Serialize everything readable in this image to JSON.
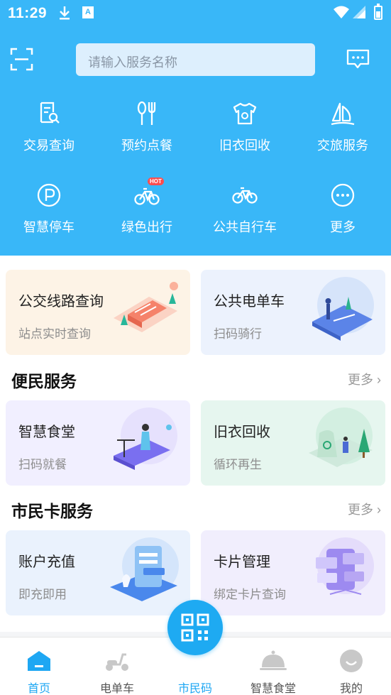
{
  "status_bar": {
    "time": "11:29",
    "notification_badge": "A"
  },
  "search": {
    "placeholder": "请输入服务名称"
  },
  "grid": [
    {
      "label": "交易查询",
      "icon": "receipt-search-icon"
    },
    {
      "label": "预约点餐",
      "icon": "fork-spoon-icon"
    },
    {
      "label": "旧衣回收",
      "icon": "shirt-recycle-icon"
    },
    {
      "label": "交旅服务",
      "icon": "sailboat-icon"
    },
    {
      "label": "智慧停车",
      "icon": "parking-icon"
    },
    {
      "label": "绿色出行",
      "icon": "bicycle-icon",
      "badge": "HOT"
    },
    {
      "label": "公共自行车",
      "icon": "bicycle-icon"
    },
    {
      "label": "更多",
      "icon": "more-dots-icon"
    }
  ],
  "travel_cards": [
    {
      "title": "公交线路查询",
      "subtitle": "站点实时查询"
    },
    {
      "title": "公共电单车",
      "subtitle": "扫码骑行"
    }
  ],
  "convenience": {
    "title": "便民服务",
    "more": "更多",
    "cards": [
      {
        "title": "智慧食堂",
        "subtitle": "扫码就餐"
      },
      {
        "title": "旧衣回收",
        "subtitle": "循环再生"
      }
    ]
  },
  "citizen_card": {
    "title": "市民卡服务",
    "more": "更多",
    "cards": [
      {
        "title": "账户充值",
        "subtitle": "即充即用"
      },
      {
        "title": "卡片管理",
        "subtitle": "绑定卡片查询"
      }
    ]
  },
  "bottom_nav": [
    {
      "label": "首页",
      "active": true
    },
    {
      "label": "电单车",
      "active": false
    },
    {
      "label": "市民码",
      "active": false
    },
    {
      "label": "智慧食堂",
      "active": false
    },
    {
      "label": "我的",
      "active": false
    }
  ],
  "colors": {
    "primary": "#39b7f8",
    "accent": "#1ea7f3"
  }
}
